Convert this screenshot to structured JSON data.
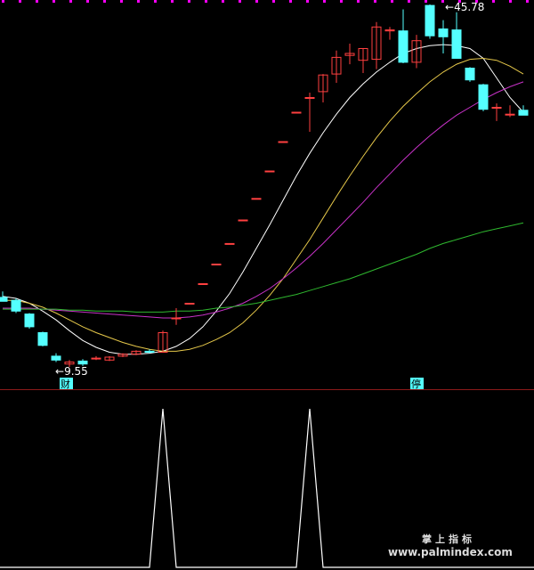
{
  "colors": {
    "background": "#000000",
    "up_candle": "#ff4040",
    "down_candle": "#54ffff",
    "ma_white": "#ffffff",
    "ma_yellow": "#e6c84a",
    "ma_magenta": "#c832c8",
    "ma_green": "#2fb82f",
    "divider": "#8b1a1a",
    "top_dots": "#ff00ff"
  },
  "chart_data": [
    {
      "type": "candlestick",
      "panel": "price",
      "annotations": {
        "high_label": "45.78",
        "low_label": "9.55",
        "low_arrow": "←",
        "high_arrow": "←",
        "badge_left": "财",
        "badge_right": "停"
      },
      "candles": [
        {
          "o": 18.6,
          "h": 19.2,
          "l": 18.2,
          "c": 18.2
        },
        {
          "o": 18.3,
          "h": 18.5,
          "l": 17.0,
          "c": 17.2
        },
        {
          "o": 16.9,
          "h": 17.0,
          "l": 15.4,
          "c": 15.6
        },
        {
          "o": 15.0,
          "h": 15.1,
          "l": 13.6,
          "c": 13.7
        },
        {
          "o": 12.6,
          "h": 12.9,
          "l": 12.0,
          "c": 12.2
        },
        {
          "o": 11.8,
          "h": 12.2,
          "l": 11.5,
          "c": 12.0
        },
        {
          "o": 12.1,
          "h": 12.3,
          "l": 11.6,
          "c": 11.8
        },
        {
          "o": 12.4,
          "h": 12.6,
          "l": 12.2,
          "c": 12.4
        },
        {
          "o": 12.2,
          "h": 12.6,
          "l": 12.1,
          "c": 12.5
        },
        {
          "o": 12.6,
          "h": 12.9,
          "l": 12.5,
          "c": 12.8
        },
        {
          "o": 12.8,
          "h": 13.2,
          "l": 12.7,
          "c": 13.1
        },
        {
          "o": 13.1,
          "h": 13.3,
          "l": 12.9,
          "c": 13.0
        },
        {
          "o": 13.0,
          "h": 15.2,
          "l": 13.0,
          "c": 15.0
        },
        {
          "o": 16.5,
          "h": 17.5,
          "l": 15.8,
          "c": 16.5
        },
        {
          "o": 18.0,
          "h": 18.0,
          "l": 18.0,
          "c": 18.0
        },
        {
          "o": 20.0,
          "h": 20.0,
          "l": 20.0,
          "c": 20.0
        },
        {
          "o": 22.0,
          "h": 22.0,
          "l": 22.0,
          "c": 22.0
        },
        {
          "o": 24.1,
          "h": 24.1,
          "l": 24.1,
          "c": 24.1
        },
        {
          "o": 26.5,
          "h": 26.5,
          "l": 26.5,
          "c": 26.5
        },
        {
          "o": 28.7,
          "h": 28.7,
          "l": 28.7,
          "c": 28.7
        },
        {
          "o": 31.5,
          "h": 31.5,
          "l": 31.5,
          "c": 31.5
        },
        {
          "o": 34.5,
          "h": 34.5,
          "l": 34.5,
          "c": 34.5
        },
        {
          "o": 37.5,
          "h": 37.5,
          "l": 37.5,
          "c": 37.5
        },
        {
          "o": 39.0,
          "h": 39.5,
          "l": 35.5,
          "c": 39.0
        },
        {
          "o": 39.6,
          "h": 41.4,
          "l": 38.5,
          "c": 41.3
        },
        {
          "o": 41.4,
          "h": 43.8,
          "l": 40.5,
          "c": 43.1
        },
        {
          "o": 43.3,
          "h": 44.5,
          "l": 42.4,
          "c": 43.5
        },
        {
          "o": 42.8,
          "h": 44.0,
          "l": 41.5,
          "c": 44.0
        },
        {
          "o": 42.9,
          "h": 46.7,
          "l": 41.9,
          "c": 46.2
        },
        {
          "o": 45.8,
          "h": 46.2,
          "l": 44.9,
          "c": 45.9
        },
        {
          "o": 45.8,
          "h": 48.0,
          "l": 42.5,
          "c": 42.6
        },
        {
          "o": 42.6,
          "h": 45.4,
          "l": 42.0,
          "c": 44.8
        },
        {
          "o": 48.4,
          "h": 48.5,
          "l": 45.0,
          "c": 45.3
        },
        {
          "o": 46.0,
          "h": 46.9,
          "l": 43.5,
          "c": 45.2
        },
        {
          "o": 45.9,
          "h": 47.7,
          "l": 43.0,
          "c": 43.0
        },
        {
          "o": 42.0,
          "h": 42.1,
          "l": 40.6,
          "c": 40.8
        },
        {
          "o": 40.3,
          "h": 40.4,
          "l": 37.6,
          "c": 37.8
        },
        {
          "o": 38.0,
          "h": 38.4,
          "l": 36.6,
          "c": 38.0
        },
        {
          "o": 37.3,
          "h": 38.2,
          "l": 37.0,
          "c": 37.3
        },
        {
          "o": 37.7,
          "h": 38.2,
          "l": 37.2,
          "c": 37.2
        }
      ],
      "ma_lines": [
        {
          "key": "white",
          "values": [
            18.7,
            18.5,
            18.0,
            17.2,
            16.3,
            15.2,
            14.2,
            13.5,
            13.0,
            12.8,
            12.8,
            12.9,
            13.1,
            13.6,
            14.4,
            15.6,
            17.2,
            19.0,
            21.2,
            23.6,
            26.0,
            28.5,
            31.0,
            33.3,
            35.4,
            37.3,
            39.0,
            40.4,
            41.6,
            42.6,
            43.5,
            44.0,
            44.3,
            44.4,
            44.3,
            44.0,
            43.0,
            41.0,
            39.0,
            37.5
          ]
        },
        {
          "key": "yellow",
          "values": [
            18.3,
            18.3,
            18.0,
            17.6,
            17.0,
            16.3,
            15.6,
            15.0,
            14.5,
            14.0,
            13.6,
            13.3,
            13.1,
            13.1,
            13.3,
            13.7,
            14.3,
            15.0,
            16.0,
            17.3,
            18.8,
            20.5,
            22.5,
            24.5,
            26.7,
            28.9,
            31.0,
            33.0,
            34.9,
            36.6,
            38.1,
            39.4,
            40.6,
            41.6,
            42.4,
            42.9,
            43.0,
            42.8,
            42.2,
            41.4
          ]
        },
        {
          "key": "magenta",
          "values": [
            17.5,
            17.5,
            17.5,
            17.4,
            17.3,
            17.2,
            17.1,
            17.0,
            16.9,
            16.8,
            16.7,
            16.6,
            16.5,
            16.5,
            16.6,
            16.8,
            17.1,
            17.5,
            18.0,
            18.7,
            19.5,
            20.5,
            21.6,
            22.8,
            24.1,
            25.5,
            26.9,
            28.3,
            29.8,
            31.2,
            32.6,
            33.9,
            35.1,
            36.2,
            37.2,
            38.0,
            38.8,
            39.5,
            40.1,
            40.6
          ]
        },
        {
          "key": "green",
          "values": [
            17.4,
            17.4,
            17.4,
            17.4,
            17.4,
            17.3,
            17.3,
            17.2,
            17.2,
            17.2,
            17.1,
            17.1,
            17.1,
            17.2,
            17.2,
            17.3,
            17.5,
            17.6,
            17.8,
            18.0,
            18.3,
            18.6,
            18.9,
            19.3,
            19.7,
            20.1,
            20.5,
            21.0,
            21.5,
            22.0,
            22.5,
            23.0,
            23.6,
            24.1,
            24.5,
            24.9,
            25.3,
            25.6,
            25.9,
            26.2
          ]
        }
      ]
    },
    {
      "type": "line",
      "panel": "signal",
      "values": [
        0,
        0,
        0,
        0,
        0,
        0,
        0,
        0,
        0,
        0,
        0,
        0,
        1,
        0,
        0,
        0,
        0,
        0,
        0,
        0,
        0,
        0,
        0,
        1,
        0,
        0,
        0,
        0,
        0,
        0,
        0,
        0,
        0,
        0,
        0,
        0,
        0,
        0,
        0,
        0
      ]
    }
  ],
  "watermark": {
    "title": "掌上指标",
    "url": "www.palmindex.com"
  }
}
